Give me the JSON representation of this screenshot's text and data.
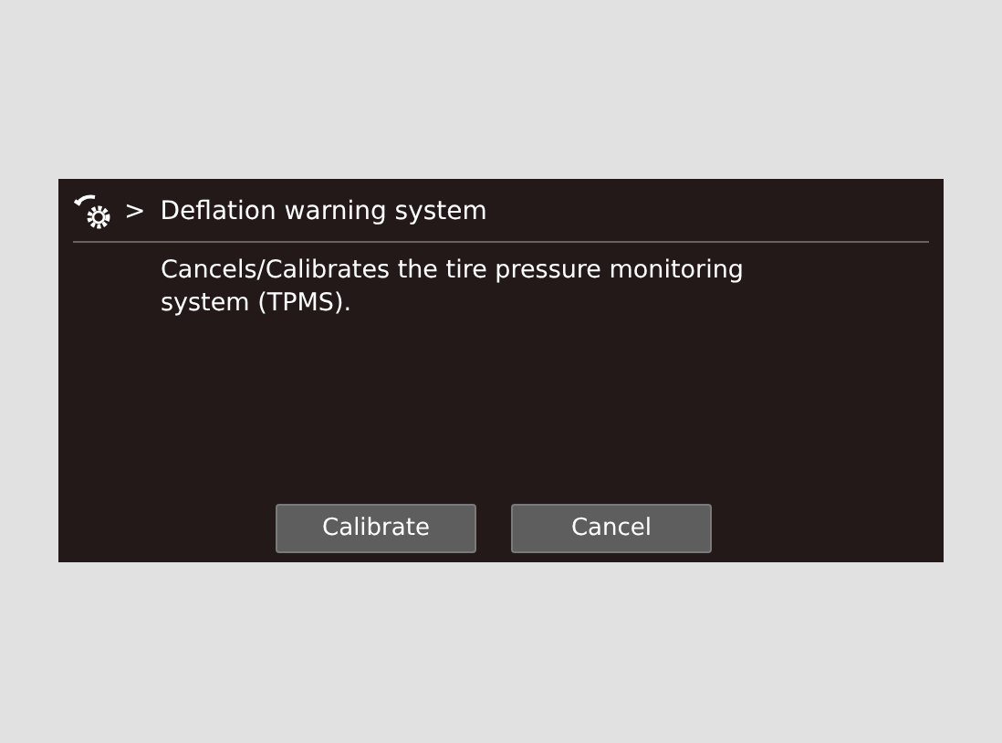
{
  "header": {
    "separator": ">",
    "title": "Deflation warning system"
  },
  "description": "Cancels/Calibrates the tire pressure monitoring system (TPMS).",
  "buttons": [
    {
      "label": "Calibrate"
    },
    {
      "label": "Cancel"
    }
  ]
}
